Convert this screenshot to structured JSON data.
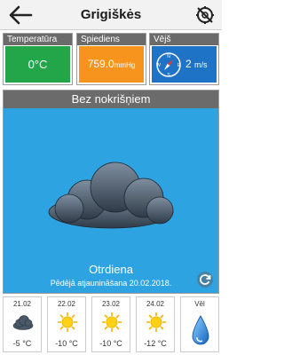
{
  "header": {
    "title": "Grigiškės"
  },
  "tiles": {
    "temperature": {
      "label": "Temperatūra",
      "value": "0°C"
    },
    "pressure": {
      "label": "Spiediens",
      "value": "759.0",
      "unit": "mmHg"
    },
    "wind": {
      "label": "Vējš",
      "value": "2",
      "unit": "m/s"
    }
  },
  "main": {
    "condition": "Bez nokrišņiem",
    "day": "Otrdiena",
    "updated": "Pēdējā atjaunināšana 20.02.2018."
  },
  "forecast": [
    {
      "date": "21.02",
      "temp": "-5 °C",
      "icon": "cloud-icon"
    },
    {
      "date": "22.02",
      "temp": "-10 °C",
      "icon": "sun-icon"
    },
    {
      "date": "23.02",
      "temp": "-10 °C",
      "icon": "sun-icon"
    },
    {
      "date": "24.02",
      "temp": "-12 °C",
      "icon": "sun-icon"
    }
  ],
  "more": {
    "label": "Vēl"
  },
  "colors": {
    "temperature": "#23a64a",
    "pressure": "#f7941d",
    "wind": "#1f73c7",
    "sky": "#2ea3e1",
    "header_gray": "#6b6b6b"
  }
}
